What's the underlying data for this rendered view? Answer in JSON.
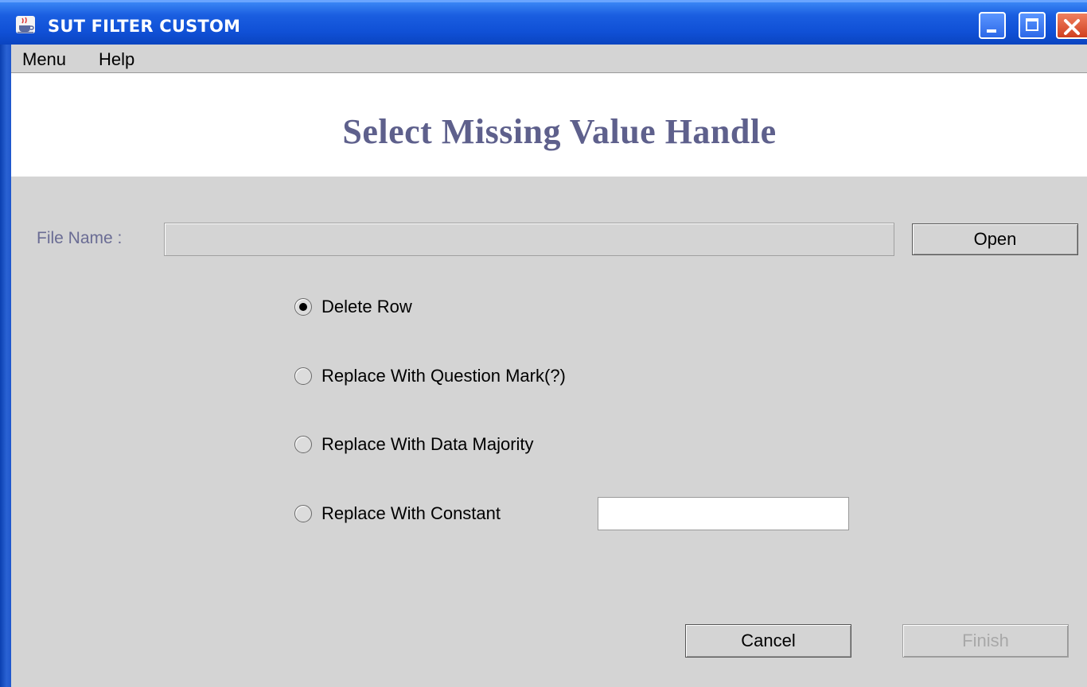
{
  "window": {
    "title": "SUT FILTER CUSTOM",
    "app_icon": "java-cup-icon"
  },
  "menubar": {
    "items": [
      {
        "label": "Menu"
      },
      {
        "label": "Help"
      }
    ]
  },
  "header": {
    "title": "Select Missing Value Handle"
  },
  "file": {
    "label": "File Name :",
    "value": "",
    "open_label": "Open"
  },
  "options": {
    "selected": "Delete Row",
    "items": [
      {
        "label": "Delete Row",
        "checked": true
      },
      {
        "label": "Replace With Question Mark(?)",
        "checked": false
      },
      {
        "label": "Replace With Data Majority",
        "checked": false
      },
      {
        "label": "Replace With Constant",
        "checked": false
      }
    ],
    "constant_value": ""
  },
  "footer": {
    "cancel_label": "Cancel",
    "finish_label": "Finish",
    "finish_enabled": false
  },
  "colors": {
    "title_bar": "#1a5ee0",
    "header_text": "#5e608c",
    "panel_bg": "#d4d4d4",
    "close_button": "#d04020"
  }
}
